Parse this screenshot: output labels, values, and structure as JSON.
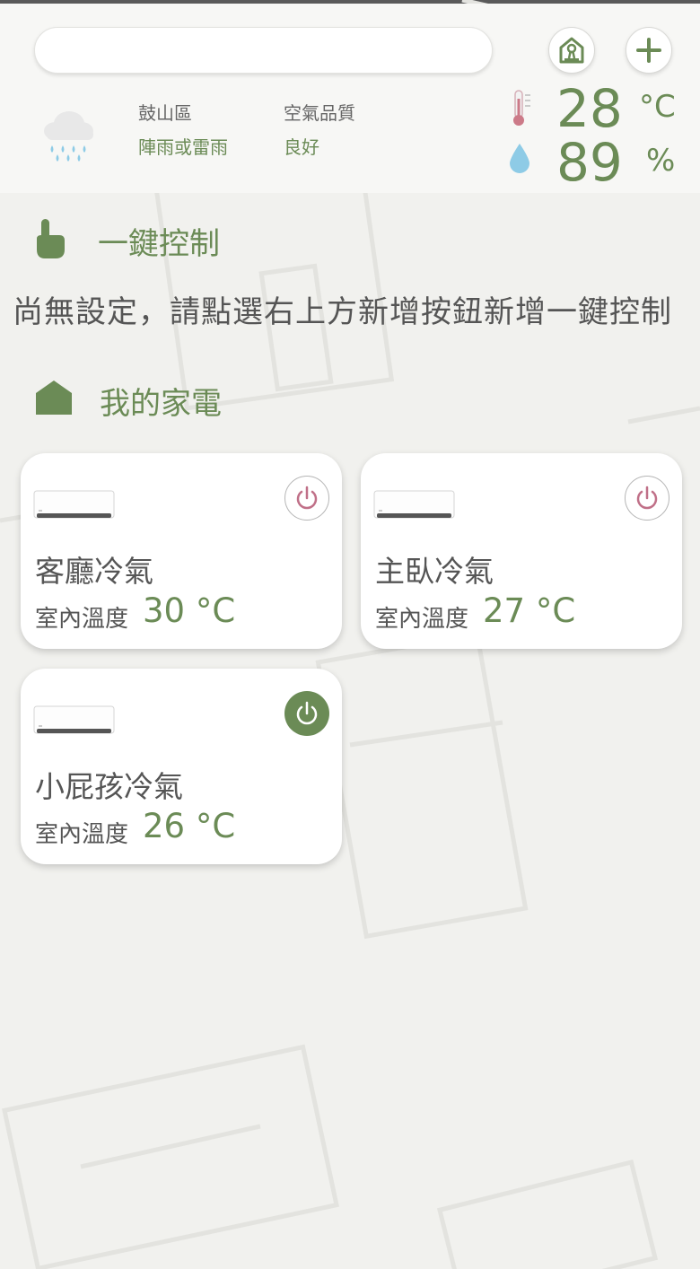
{
  "search": {
    "value": "",
    "placeholder": ""
  },
  "header_buttons": {
    "home_icon": "house-keyhole-icon",
    "add_icon": "plus-icon"
  },
  "weather": {
    "icon": "rain-cloud-icon",
    "district": "鼓山區",
    "condition": "陣雨或雷雨",
    "air_quality_label": "空氣品質",
    "air_quality_value": "良好",
    "temperature": "28",
    "temperature_unit": "°C",
    "humidity": "89",
    "humidity_unit": "%"
  },
  "one_click": {
    "title": "一鍵控制",
    "icon": "pointing-hand-icon",
    "empty_message": "尚無設定，請點選右上方新增按鈕新增一鍵控制"
  },
  "appliances": {
    "title": "我的家電",
    "icon": "home-icon",
    "temp_label": "室內溫度",
    "items": [
      {
        "name": "客廳冷氣",
        "temp": "30 °C",
        "power": "off"
      },
      {
        "name": "主臥冷氣",
        "temp": "27 °C",
        "power": "off"
      },
      {
        "name": "小屁孩冷氣",
        "temp": "26 °C",
        "power": "on"
      }
    ]
  },
  "colors": {
    "accent": "#6b8b56",
    "power_off": "#c07088",
    "background": "#f1f1ee"
  }
}
